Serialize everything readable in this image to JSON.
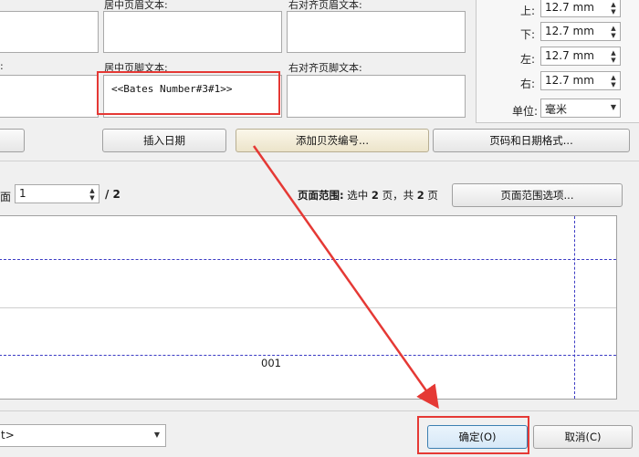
{
  "header": {
    "center_label": "居中页眉文本:",
    "right_label": "右对齐页眉文本:"
  },
  "footer": {
    "left_label_fragment": ":",
    "center_label": "居中页脚文本:",
    "center_value": "<<Bates Number#3#1>>",
    "right_label": "右对齐页脚文本:"
  },
  "margins": {
    "top": {
      "label": "上:",
      "value": "12.7 mm"
    },
    "bottom": {
      "label": "下:",
      "value": "12.7 mm"
    },
    "left": {
      "label": "左:",
      "value": "12.7 mm"
    },
    "right": {
      "label": "右:",
      "value": "12.7 mm"
    },
    "unit": {
      "label": "单位:",
      "value": "毫米"
    }
  },
  "toolbar": {
    "insert_date": "插入日期",
    "add_bates": "添加贝茨编号...",
    "page_format": "页码和日期格式..."
  },
  "page_nav": {
    "label": "面",
    "value": "1",
    "total": "/ 2"
  },
  "page_range": {
    "label": "页面范围:",
    "text_pre": "选中",
    "selected": "2",
    "text_mid": "页，共",
    "total": "2",
    "text_post": "页",
    "button": "页面范围选项..."
  },
  "preview": {
    "footer_text": "001"
  },
  "bottom": {
    "preset_value": "t>",
    "ok": "确定(O)",
    "cancel": "取消(C)"
  },
  "colors": {
    "annotation": "#e53935",
    "guide": "#3b3bc4"
  }
}
